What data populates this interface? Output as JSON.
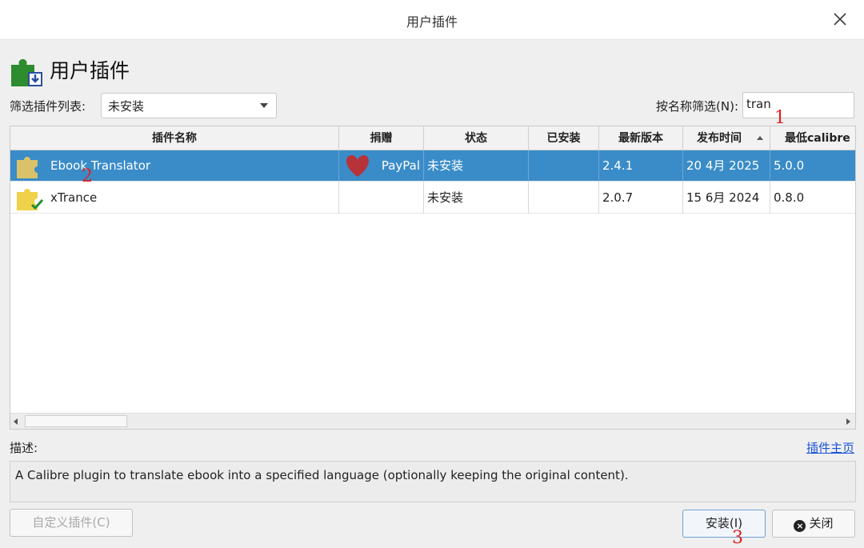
{
  "window": {
    "title": "用户插件"
  },
  "heading": {
    "text": "用户插件",
    "icon": "puzzle-piece-download-icon"
  },
  "filter": {
    "label": "筛选插件列表:",
    "selected": "未安装"
  },
  "name_filter": {
    "label": "按名称筛选(N):",
    "value": "tran"
  },
  "table": {
    "columns": [
      "插件名称",
      "捐赠",
      "状态",
      "已安装",
      "最新版本",
      "发布时间",
      "最低calibre"
    ],
    "rows": [
      {
        "name": "Ebook Translator",
        "donate": "PayPal",
        "status": "未安装",
        "installed": "",
        "latest": "2.4.1",
        "released": "20 4月 2025",
        "min_calibre": "5.0.0"
      },
      {
        "name": "xTrance",
        "donate": "",
        "status": "未安装",
        "installed": "",
        "latest": "2.0.7",
        "released": "15 6月 2024",
        "min_calibre": "0.8.0"
      }
    ]
  },
  "description": {
    "label": "描述:",
    "homepage": "插件主页",
    "text": "A Calibre plugin to translate ebook into a specified language (optionally keeping the original content)."
  },
  "buttons": {
    "customize": "自定义插件(C)",
    "install": "安装(I)",
    "close": "关闭"
  },
  "annotations": [
    "1",
    "2",
    "3"
  ],
  "colors": {
    "selection": "#3a8cc8",
    "link": "#1a55d6",
    "annotation": "#e02020"
  }
}
